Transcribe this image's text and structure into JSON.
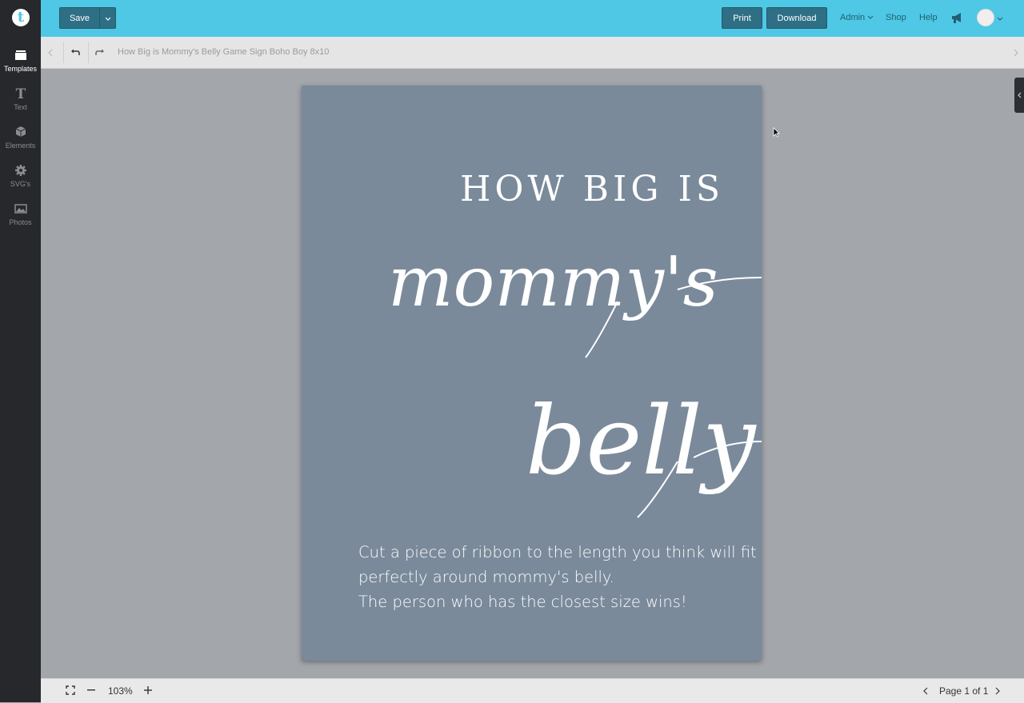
{
  "sidebar": {
    "logo_letter": "t",
    "items": [
      {
        "label": "Templates",
        "icon": "folder-icon",
        "active": true
      },
      {
        "label": "Text",
        "icon": "text-icon",
        "active": false
      },
      {
        "label": "Elements",
        "icon": "cube-icon",
        "active": false
      },
      {
        "label": "SVG's",
        "icon": "gear-icon",
        "active": false
      },
      {
        "label": "Photos",
        "icon": "image-icon",
        "active": false
      }
    ]
  },
  "toolbar": {
    "save_label": "Save",
    "print_label": "Print",
    "download_label": "Download",
    "admin_label": "Admin",
    "shop_label": "Shop",
    "help_label": "Help"
  },
  "subbar": {
    "document_title": "How Big is Mommy's Belly Game Sign Boho Boy 8x10"
  },
  "design": {
    "headline": "HOW BIG IS",
    "script_line1": "mommy's",
    "script_line2": "belly",
    "body_lines": [
      "Cut a piece of ribbon to the length you think will fit",
      "perfectly around mommy's belly.",
      "The person who has the closest size wins!"
    ]
  },
  "footer": {
    "zoom": "103%",
    "page_indicator": "Page 1 of 1"
  },
  "colors": {
    "topbar": "#4ec8e4",
    "button": "#2e6f85",
    "sidebar": "#27282b",
    "page_background": "#7a8a9b",
    "canvas": "#a3a6ab"
  }
}
